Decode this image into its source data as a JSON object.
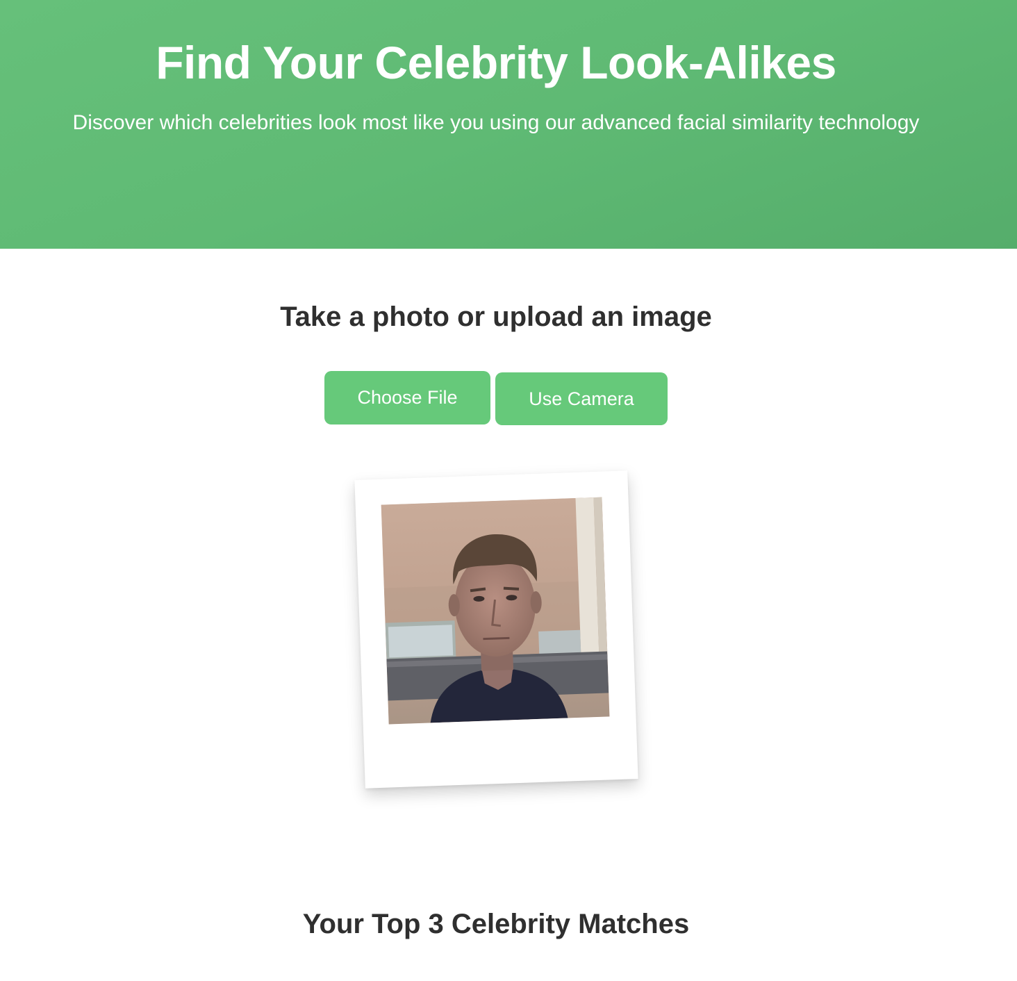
{
  "hero": {
    "title": "Find Your Celebrity Look-Alikes",
    "subtitle": "Discover which celebrities look most like you using our advanced facial similarity technology"
  },
  "upload": {
    "heading": "Take a photo or upload an image",
    "choose_file_label": "Choose File",
    "use_camera_label": "Use Camera"
  },
  "results": {
    "heading": "Your Top 3 Celebrity Matches"
  },
  "colors": {
    "hero_green": "#5fba74",
    "button_green": "#66c97a",
    "heading_text": "#2f2f2f"
  }
}
